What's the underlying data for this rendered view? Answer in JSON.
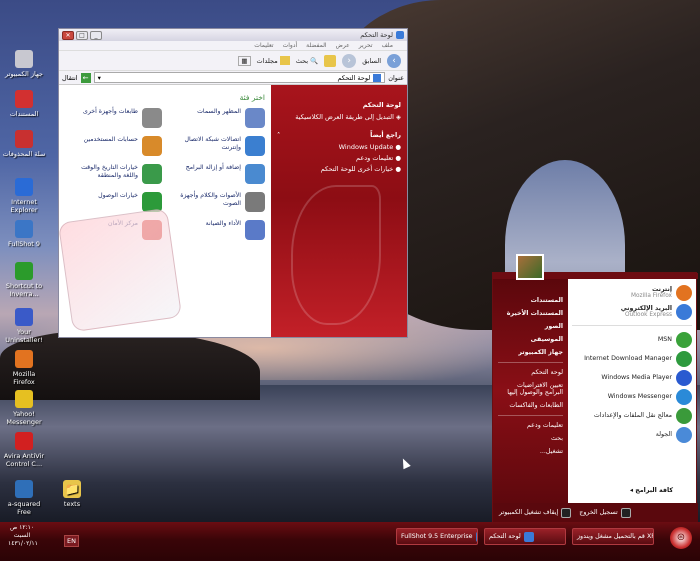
{
  "desktop_icons": [
    {
      "label": "جهاز الكمبيوتر",
      "icon": "computer-icon",
      "color": "#c8c8d0"
    },
    {
      "label": "المستندات",
      "icon": "documents-icon",
      "color": "#d23030"
    },
    {
      "label": "سلة المحذوفات",
      "icon": "recycle-bin-icon",
      "color": "#c83030"
    },
    {
      "label": "Internet Explorer",
      "icon": "ie-icon",
      "color": "#2a6bd6"
    },
    {
      "label": "FullShot 9",
      "icon": "fullshot-icon",
      "color": "#3b76c6"
    },
    {
      "label": "Shortcut to Inverra...",
      "icon": "evs-icon",
      "color": "#2b9b2b"
    },
    {
      "label": "Your Uninstaller!",
      "icon": "uninstaller-icon",
      "color": "#3a5ac8"
    },
    {
      "label": "Mozilla Firefox",
      "icon": "firefox-icon",
      "color": "#e27320"
    },
    {
      "label": "Yahoo! Messenger",
      "icon": "yahoo-messenger-icon",
      "color": "#e6c021"
    },
    {
      "label": "Avira AntiVir Control C...",
      "icon": "avira-icon",
      "color": "#d22020"
    },
    {
      "label": "a-squared Free",
      "icon": "a-squared-icon",
      "color": "#2f6fb8"
    }
  ],
  "texts_folder": {
    "label": "texts"
  },
  "control_panel": {
    "title": "لوحة التحكم",
    "menu": [
      "ملف",
      "تحرير",
      "عرض",
      "المفضلة",
      "أدوات",
      "تعليمات"
    ],
    "toolbar": {
      "back": "السابق",
      "search": "بحث",
      "folders": "مجلدات",
      "views": "▦"
    },
    "address_label": "عنوان",
    "address_value": "لوحة التحكم",
    "go_label": "انتقال",
    "side": {
      "panel_title": "لوحة التحكم",
      "switch_view": "التبديل إلى طريقة العرض الكلاسيكية",
      "see_also": "راجع أيضاً",
      "links": [
        "Windows Update",
        "تعليمات ودعم",
        "خيارات أخرى للوحة التحكم"
      ]
    },
    "main_title": "اختر فئة",
    "categories": [
      {
        "label": "المظهر والسمات",
        "icon": "appearance-icon",
        "color": "#6a88c8"
      },
      {
        "label": "طابعات وأجهزة أخرى",
        "icon": "printers-icon",
        "color": "#8a8a8a"
      },
      {
        "label": "اتصالات شبكة الاتصال وإنترنت",
        "icon": "network-icon",
        "color": "#3b7fd0"
      },
      {
        "label": "حسابات المستخدمين",
        "icon": "user-accounts-icon",
        "color": "#d88a2a"
      },
      {
        "label": "إضافة أو إزالة البرامج",
        "icon": "add-remove-icon",
        "color": "#4a8ad0"
      },
      {
        "label": "خيارات التاريخ والوقت واللغة والمنطقة",
        "icon": "date-time-icon",
        "color": "#3a9a4a"
      },
      {
        "label": "الأصوات والكلام وأجهزة الصوت",
        "icon": "sounds-icon",
        "color": "#7a7a7a"
      },
      {
        "label": "خيارات الوصول",
        "icon": "accessibility-icon",
        "color": "#2c9a3a"
      },
      {
        "label": "الأداء والصيانة",
        "icon": "performance-icon",
        "color": "#5a7ac8"
      },
      {
        "label": "مركز الأمان",
        "icon": "security-center-icon",
        "color": "#d8342a"
      }
    ]
  },
  "start_menu": {
    "pinned": [
      {
        "title": "إنترنت",
        "sub": "Mozilla Firefox",
        "icon": "firefox-icon",
        "color": "#e27320"
      },
      {
        "title": "البريد الإلكتروني",
        "sub": "Outlook Express",
        "icon": "outlook-icon",
        "color": "#3a7ad8"
      }
    ],
    "recent": [
      {
        "title": "MSN",
        "icon": "msn-icon",
        "color": "#3aa23a"
      },
      {
        "title": "Internet Download Manager",
        "icon": "idm-icon",
        "color": "#2e9a3e"
      },
      {
        "title": "Windows Media Player",
        "icon": "media-player-icon",
        "color": "#2a5ad0"
      },
      {
        "title": "Windows Messenger",
        "icon": "messenger-icon",
        "color": "#2a8ad8"
      },
      {
        "title": "معالج نقل الملفات والإعدادات",
        "icon": "transfer-wizard-icon",
        "color": "#3a9a3a"
      },
      {
        "title": "الجولة",
        "icon": "tour-icon",
        "color": "#4a8ad8"
      }
    ],
    "all_programs": "كافة البرامج",
    "left_items": [
      {
        "label": "المستندات",
        "bold": true
      },
      {
        "label": "المستندات الأخيرة",
        "bold": true
      },
      {
        "label": "الصور",
        "bold": true
      },
      {
        "label": "الموسيقى",
        "bold": true
      },
      {
        "label": "جهاز الكمبيوتر",
        "bold": true
      },
      {
        "label": "لوحة التحكم",
        "bold": false
      },
      {
        "label": "تعيين الافتراضيات البرامج والوصول إليها",
        "bold": false
      },
      {
        "label": "الطابعات والفاكسات",
        "bold": false
      },
      {
        "label": "تعليمات ودعم",
        "bold": false
      },
      {
        "label": "بحث",
        "bold": false
      },
      {
        "label": "تشغيل...",
        "bold": false
      }
    ],
    "logoff": "تسجيل الخروج",
    "shutdown": "إيقاف تشغيل الكمبيوتر"
  },
  "taskbar": {
    "tasks": [
      {
        "label": "FullShot 9.5 Enterprise",
        "icon": "fullshot-icon",
        "color": "#3b76c6"
      },
      {
        "label": "لوحة التحكم",
        "icon": "control-panel-icon",
        "color": "#3a7ad8"
      },
      {
        "label": "قم بالتحميل مشغل ويندوز XP...",
        "icon": "firefox-icon",
        "color": "#e27320"
      }
    ],
    "clock_time": "١٢:١٠ ص",
    "clock_day": "السبت",
    "clock_date": "١٤٣١/٠٢/١١",
    "lang": "EN"
  }
}
